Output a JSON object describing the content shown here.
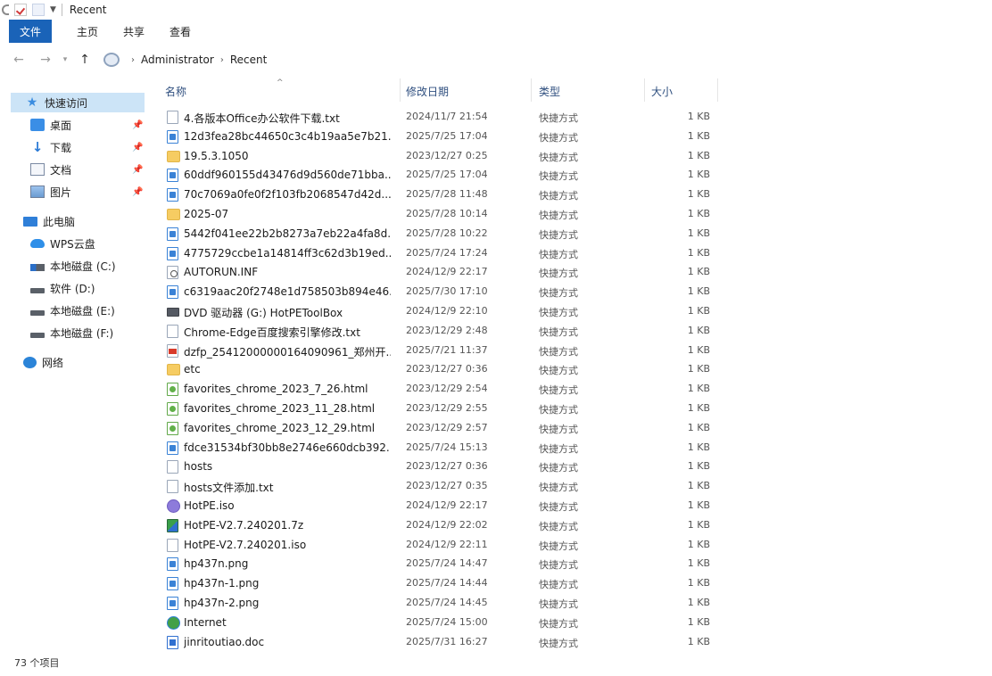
{
  "title": {
    "text": "Recent"
  },
  "ribbon": {
    "tabs": [
      "文件",
      "主页",
      "共享",
      "查看"
    ]
  },
  "address": {
    "crumbs": [
      "Administrator",
      "Recent"
    ]
  },
  "nav": {
    "quick_access": "快速访问",
    "pinned": [
      {
        "label": "桌面",
        "icon": "desktop-icon"
      },
      {
        "label": "下载",
        "icon": "download-icon"
      },
      {
        "label": "文档",
        "icon": "documents-icon"
      },
      {
        "label": "图片",
        "icon": "pictures-icon"
      }
    ],
    "this_pc": "此电脑",
    "pc_items": [
      {
        "label": "WPS云盘",
        "icon": "cloud-icon"
      },
      {
        "label": "本地磁盘 (C:)",
        "icon": "drive-icon"
      },
      {
        "label": "软件 (D:)",
        "icon": "drive-icon"
      },
      {
        "label": "本地磁盘 (E:)",
        "icon": "drive-icon"
      },
      {
        "label": "本地磁盘 (F:)",
        "icon": "drive-icon"
      }
    ],
    "network": "网络"
  },
  "columns": {
    "name": "名称",
    "date": "修改日期",
    "type": "类型",
    "size": "大小"
  },
  "files": [
    {
      "name": "4.各版本Office办公软件下载.txt",
      "date": "2024/11/7 21:54",
      "type": "快捷方式",
      "size": "1 KB",
      "icon": "text-file"
    },
    {
      "name": "12d3fea28bc44650c3c4b19aa5e7b21...",
      "date": "2025/7/25 17:04",
      "type": "快捷方式",
      "size": "1 KB",
      "icon": "image-file"
    },
    {
      "name": "19.5.3.1050",
      "date": "2023/12/27 0:25",
      "type": "快捷方式",
      "size": "1 KB",
      "icon": "folder"
    },
    {
      "name": "60ddf960155d43476d9d560de71bba...",
      "date": "2025/7/25 17:04",
      "type": "快捷方式",
      "size": "1 KB",
      "icon": "image-file"
    },
    {
      "name": "70c7069a0fe0f2f103fb2068547d42d...",
      "date": "2025/7/28 11:48",
      "type": "快捷方式",
      "size": "1 KB",
      "icon": "image-file"
    },
    {
      "name": "2025-07",
      "date": "2025/7/28 10:14",
      "type": "快捷方式",
      "size": "1 KB",
      "icon": "folder"
    },
    {
      "name": "5442f041ee22b2b8273a7eb22a4fa8d...",
      "date": "2025/7/28 10:22",
      "type": "快捷方式",
      "size": "1 KB",
      "icon": "image-file"
    },
    {
      "name": "4775729ccbe1a14814ff3c62d3b19ed...",
      "date": "2025/7/24 17:24",
      "type": "快捷方式",
      "size": "1 KB",
      "icon": "image-file"
    },
    {
      "name": "AUTORUN.INF",
      "date": "2024/12/9 22:17",
      "type": "快捷方式",
      "size": "1 KB",
      "icon": "ini-file"
    },
    {
      "name": "c6319aac20f2748e1d758503b894e46...",
      "date": "2025/7/30 17:10",
      "type": "快捷方式",
      "size": "1 KB",
      "icon": "image-file"
    },
    {
      "name": "DVD 驱动器 (G:) HotPEToolBox",
      "date": "2024/12/9 22:10",
      "type": "快捷方式",
      "size": "1 KB",
      "icon": "dvd-drive"
    },
    {
      "name": "Chrome-Edge百度搜索引擎修改.txt",
      "date": "2023/12/29 2:48",
      "type": "快捷方式",
      "size": "1 KB",
      "icon": "text-file"
    },
    {
      "name": "dzfp_25412000000164090961_郑州开...",
      "date": "2025/7/21 11:37",
      "type": "快捷方式",
      "size": "1 KB",
      "icon": "pdf-file"
    },
    {
      "name": "etc",
      "date": "2023/12/27 0:36",
      "type": "快捷方式",
      "size": "1 KB",
      "icon": "folder"
    },
    {
      "name": "favorites_chrome_2023_7_26.html",
      "date": "2023/12/29 2:54",
      "type": "快捷方式",
      "size": "1 KB",
      "icon": "html-file"
    },
    {
      "name": "favorites_chrome_2023_11_28.html",
      "date": "2023/12/29 2:55",
      "type": "快捷方式",
      "size": "1 KB",
      "icon": "html-file"
    },
    {
      "name": "favorites_chrome_2023_12_29.html",
      "date": "2023/12/29 2:57",
      "type": "快捷方式",
      "size": "1 KB",
      "icon": "html-file"
    },
    {
      "name": "fdce31534bf30bb8e2746e660dcb392...",
      "date": "2025/7/24 15:13",
      "type": "快捷方式",
      "size": "1 KB",
      "icon": "image-file"
    },
    {
      "name": "hosts",
      "date": "2023/12/27 0:36",
      "type": "快捷方式",
      "size": "1 KB",
      "icon": "blank-file"
    },
    {
      "name": "hosts文件添加.txt",
      "date": "2023/12/27 0:35",
      "type": "快捷方式",
      "size": "1 KB",
      "icon": "text-file"
    },
    {
      "name": "HotPE.iso",
      "date": "2024/12/9 22:17",
      "type": "快捷方式",
      "size": "1 KB",
      "icon": "iso-file"
    },
    {
      "name": "HotPE-V2.7.240201.7z",
      "date": "2024/12/9 22:02",
      "type": "快捷方式",
      "size": "1 KB",
      "icon": "archive-file"
    },
    {
      "name": "HotPE-V2.7.240201.iso",
      "date": "2024/12/9 22:11",
      "type": "快捷方式",
      "size": "1 KB",
      "icon": "blank-file"
    },
    {
      "name": "hp437n.png",
      "date": "2025/7/24 14:47",
      "type": "快捷方式",
      "size": "1 KB",
      "icon": "image-file"
    },
    {
      "name": "hp437n-1.png",
      "date": "2025/7/24 14:44",
      "type": "快捷方式",
      "size": "1 KB",
      "icon": "image-file"
    },
    {
      "name": "hp437n-2.png",
      "date": "2025/7/24 14:45",
      "type": "快捷方式",
      "size": "1 KB",
      "icon": "image-file"
    },
    {
      "name": "Internet",
      "date": "2025/7/24 15:00",
      "type": "快捷方式",
      "size": "1 KB",
      "icon": "internet-shortcut"
    },
    {
      "name": "jinritoutiao.doc",
      "date": "2025/7/31 16:27",
      "type": "快捷方式",
      "size": "1 KB",
      "icon": "word-file"
    }
  ],
  "status": {
    "count": "73 个项目"
  }
}
